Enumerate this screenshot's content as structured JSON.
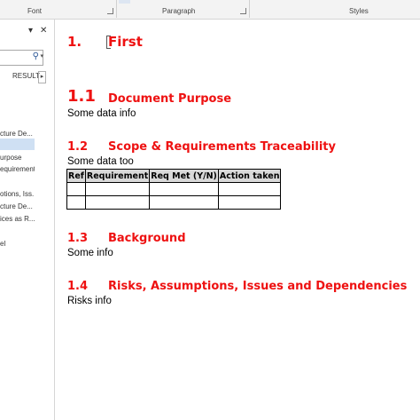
{
  "ribbon": {
    "groups": [
      {
        "label": "Font"
      },
      {
        "label": "Paragraph"
      },
      {
        "label": "Styles"
      }
    ]
  },
  "nav_pane": {
    "dropdown_glyph": "▾",
    "close_glyph": "✕",
    "search_icon": "magnifier-icon",
    "results_tab": "RESULT",
    "results_arrow": "▸",
    "items": [
      "cture De...",
      "",
      "urpose",
      "equirement...",
      "",
      "otions, Iss...",
      "cture De...",
      "ices as R...",
      "",
      "el"
    ]
  },
  "document": {
    "heading1": {
      "number": "1.",
      "text": "First"
    },
    "sections": [
      {
        "number": "1.1",
        "title": "Document Purpose",
        "body": "Some data info"
      },
      {
        "number": "1.2",
        "title": "Scope & Requirements Traceability",
        "body": "Some data too"
      },
      {
        "number": "1.3",
        "title": "Background",
        "body": "Some info"
      },
      {
        "number": "1.4",
        "title": "Risks, Assumptions, Issues and Dependencies",
        "body": "Risks info"
      }
    ],
    "table": {
      "headers": [
        "Ref",
        "Requirement",
        "Req Met (Y/N)",
        "Action taken"
      ],
      "rows": [
        [
          "",
          "",
          "",
          ""
        ],
        [
          "",
          "",
          "",
          ""
        ]
      ]
    }
  },
  "colors": {
    "heading": "#ee1111",
    "nav_selected": "#cfe0f3",
    "table_header_bg": "#d9d9d9"
  }
}
